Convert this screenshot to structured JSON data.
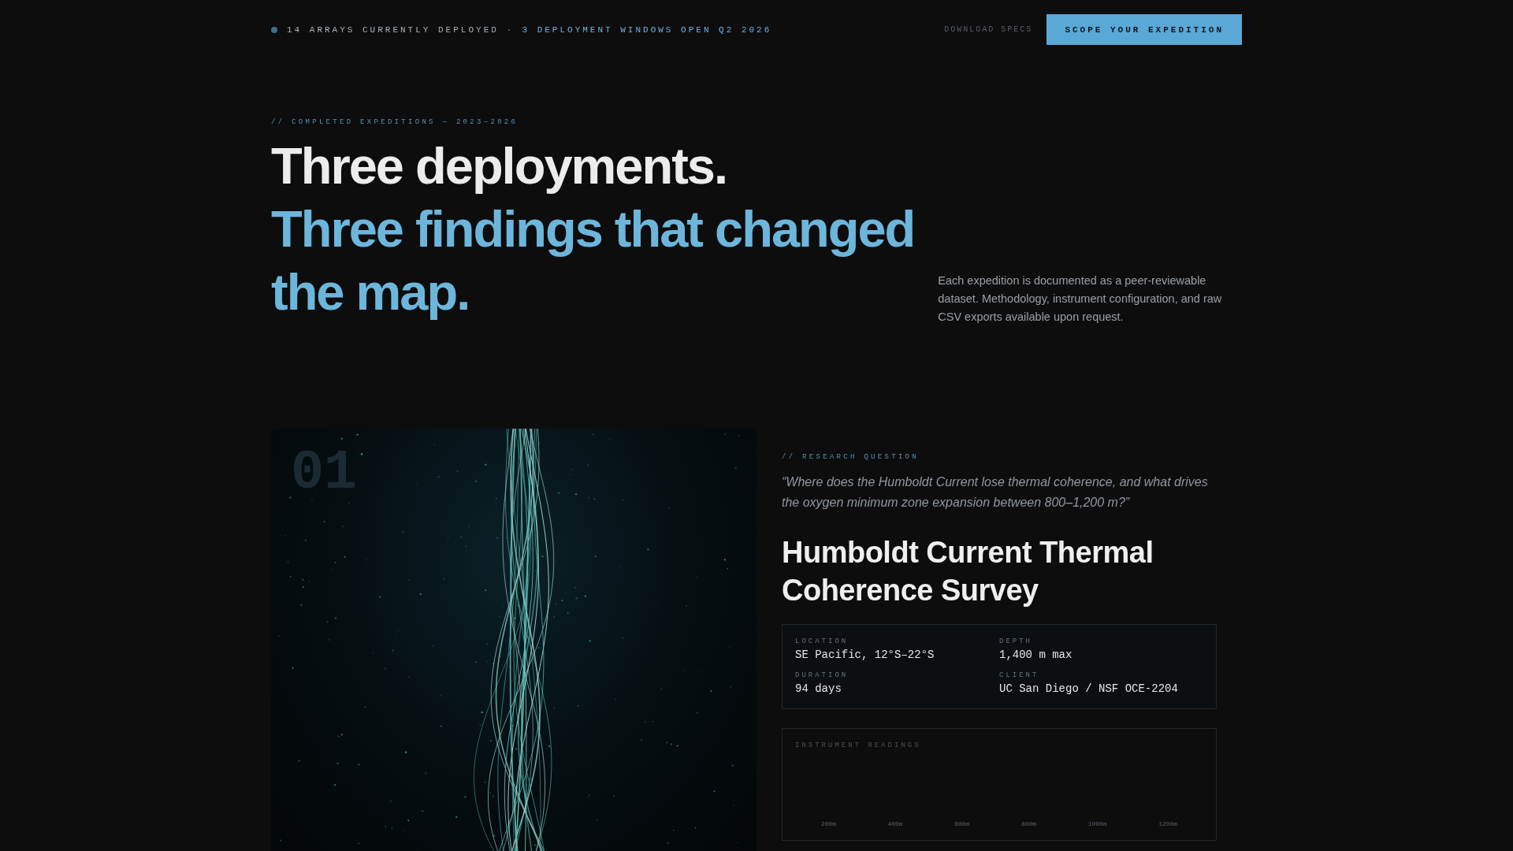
{
  "top_bar": {
    "status": "14 ARRAYS CURRENTLY DEPLOYED",
    "separator": "·",
    "highlight": "3 DEPLOYMENT WINDOWS OPEN Q2 2026",
    "link": "DOWNLOAD SPECS",
    "button": "SCOPE YOUR EXPEDITION"
  },
  "hero": {
    "eyebrow": "// COMPLETED EXPEDITIONS — 2023–2026",
    "headline": "Three deployments.",
    "headline_accent": "Three findings that changed the map.",
    "intro": "Each expedition is documented as a peer-reviewable dataset. Methodology, instrument configuration, and raw CSV exports available upon request."
  },
  "expedition": {
    "number": "01",
    "eyebrow": "// RESEARCH QUESTION",
    "question": "“Where does the Humboldt Current lose thermal coherence, and what drives the oxygen minimum zone expansion between 800–1,200 m?”",
    "title": "Humboldt Current Thermal Coherence Survey",
    "facts": [
      {
        "label": "LOCATION",
        "value": "SE Pacific, 12°S–22°S"
      },
      {
        "label": "DEPTH",
        "value": "1,400 m max"
      },
      {
        "label": "DURATION",
        "value": "94 days"
      },
      {
        "label": "CLIENT",
        "value": "UC San Diego / NSF OCE-2204"
      }
    ],
    "readings": {
      "title": "INSTRUMENT READINGS",
      "axis_labels": [
        "200m",
        "400m",
        "600m",
        "800m",
        "1000m",
        "1200m"
      ]
    }
  }
}
